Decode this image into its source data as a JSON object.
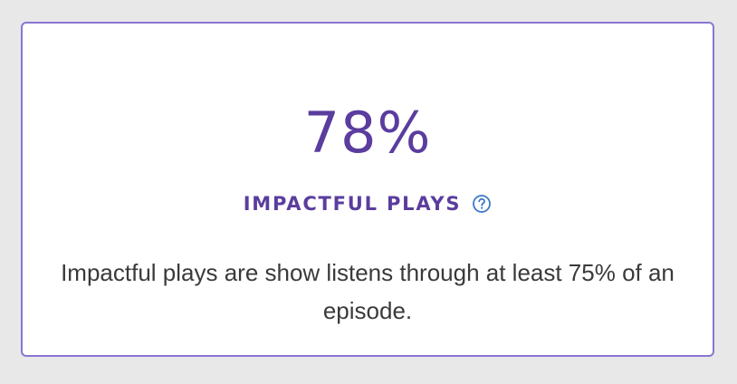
{
  "card": {
    "value": "78%",
    "label": "IMPACTFUL PLAYS",
    "help_icon": "question-circle-icon",
    "description": "Impactful plays are show listens through at least 75% of an episode."
  },
  "colors": {
    "accent": "#5a3d9e",
    "border": "#8a76d2",
    "help_icon": "#3d79c9",
    "text": "#3a3a3a",
    "background": "#e8e8e8",
    "card_background": "#ffffff"
  }
}
